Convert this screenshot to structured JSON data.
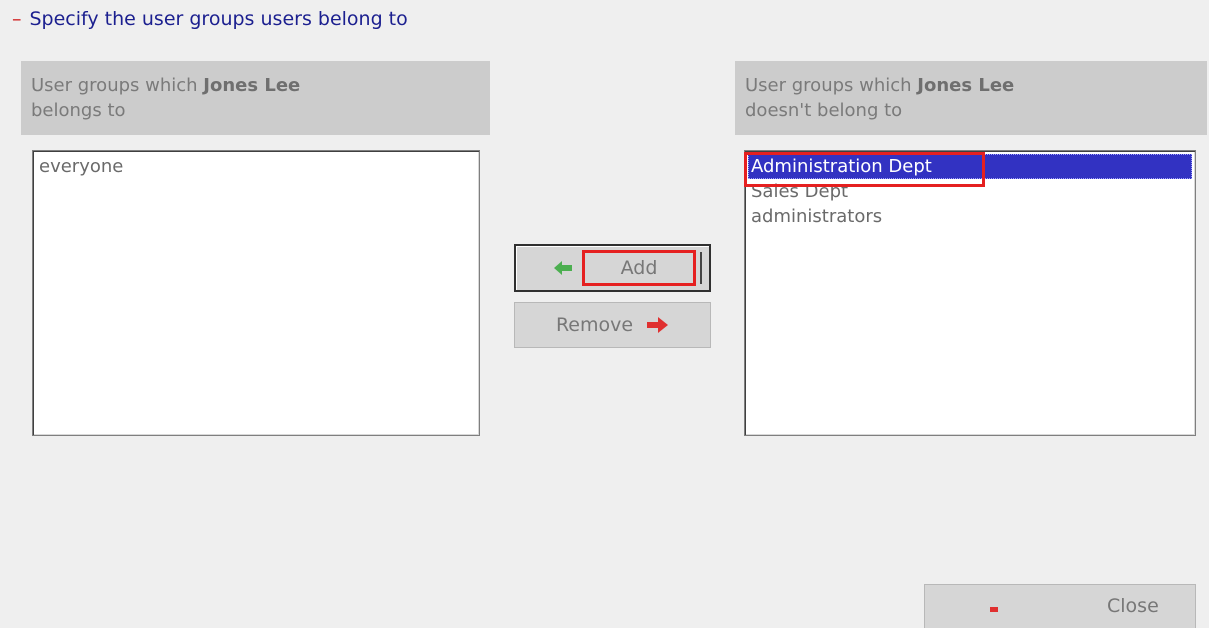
{
  "section": {
    "collapse_symbol": "–",
    "title": "Specify the user groups users belong to"
  },
  "left_panel": {
    "header_prefix": "User groups which ",
    "user_name": "Jones Lee",
    "header_suffix": "belongs to",
    "items": [
      "everyone"
    ]
  },
  "right_panel": {
    "header_prefix": "User groups which ",
    "user_name": "Jones Lee",
    "header_suffix": "doesn't belong to",
    "items": [
      "Administration Dept",
      "Sales Dept",
      "administrators"
    ],
    "selected_index": 0
  },
  "buttons": {
    "add_label": "Add",
    "add_icon": "arrow-left-icon",
    "remove_label": "Remove",
    "remove_icon": "arrow-right-icon",
    "close_label": "Close",
    "close_icon": "minus-icon"
  },
  "colors": {
    "title": "#1b1f8f",
    "selection": "#3232c2",
    "highlight": "#e52020",
    "add_arrow": "#4caf50",
    "remove_arrow": "#e03030"
  }
}
